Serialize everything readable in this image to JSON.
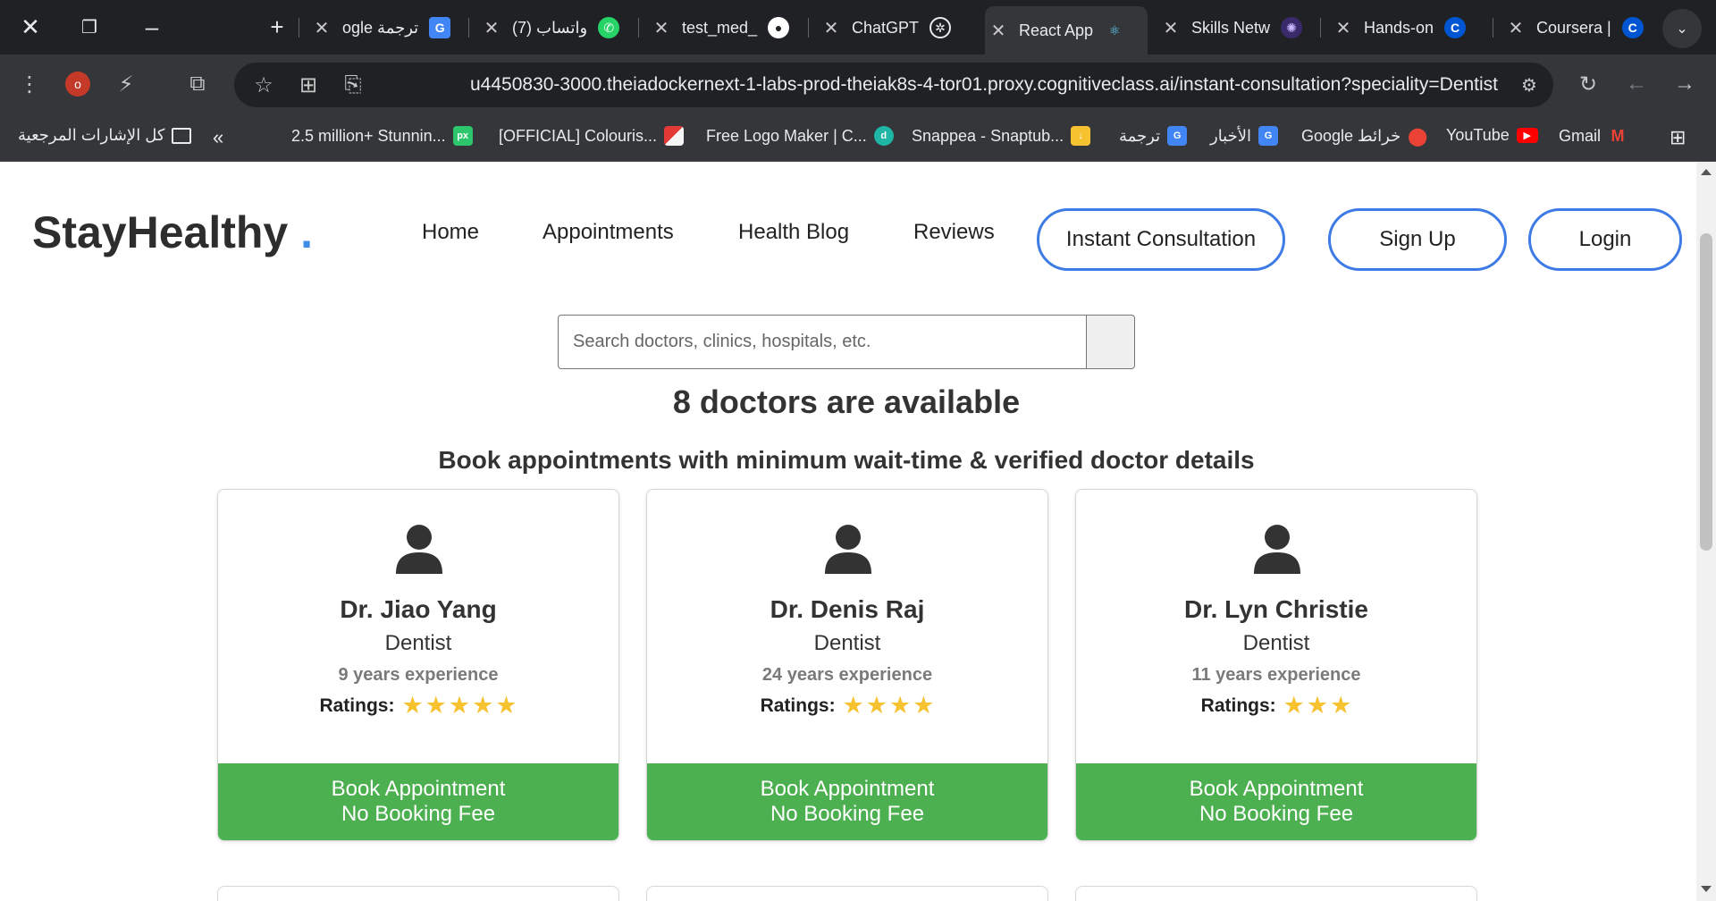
{
  "browser": {
    "tabs": [
      {
        "title": "ogle ترجمة",
        "icon": "google-translate-icon"
      },
      {
        "title": "(7) واتساب",
        "icon": "whatsapp-icon"
      },
      {
        "title": "test_med_",
        "icon": "github-icon"
      },
      {
        "title": "ChatGPT",
        "icon": "chatgpt-icon"
      },
      {
        "title": "React App",
        "icon": "react-icon",
        "active": true
      },
      {
        "title": "Skills Netw",
        "icon": "skills-network-icon"
      },
      {
        "title": "Hands-on",
        "icon": "coursera-icon"
      },
      {
        "title": "Coursera |",
        "icon": "coursera-icon"
      }
    ],
    "profile_initial": "o",
    "url": "u4450830-3000.theiadockernext-1-labs-prod-theiak8s-4-tor01.proxy.cognitiveclass.ai/instant-consultation?speciality=Dentist",
    "bookmarks": [
      {
        "label": "كل الإشارات المرجعية"
      },
      {
        "label": "2.5 million+ Stunnin...",
        "badge": "px"
      },
      {
        "label": "[OFFICIAL] Colouris..."
      },
      {
        "label": "Free Logo Maker | C..."
      },
      {
        "label": "Snappea - Snaptub..."
      },
      {
        "label": "ترجمة"
      },
      {
        "label": "الأخبار"
      },
      {
        "label": "Google خرائط"
      },
      {
        "label": "YouTube"
      },
      {
        "label": "Gmail"
      }
    ]
  },
  "site": {
    "logo": "StayHealthy",
    "logo_dot": ".",
    "nav": {
      "home": "Home",
      "appointments": "Appointments",
      "blog": "Health Blog",
      "reviews": "Reviews",
      "instant": "Instant Consultation",
      "signup": "Sign Up",
      "login": "Login"
    },
    "search": {
      "placeholder": "Search doctors, clinics, hospitals, etc.",
      "value": ""
    },
    "headline": "8 doctors are available",
    "subhead": "Book appointments with minimum wait-time & verified doctor details",
    "rating_label": "Ratings:",
    "book_line1": "Book Appointment",
    "book_line2": "No Booking Fee",
    "doctors": [
      {
        "name": "Dr. Jiao Yang",
        "speciality": "Dentist",
        "experience": "9 years experience",
        "stars": 5
      },
      {
        "name": "Dr. Denis Raj",
        "speciality": "Dentist",
        "experience": "24 years experience",
        "stars": 4
      },
      {
        "name": "Dr. Lyn Christie",
        "speciality": "Dentist",
        "experience": "11 years experience",
        "stars": 3
      }
    ]
  },
  "colors": {
    "accent_blue": "#3e7be5",
    "book_green": "#4caf50",
    "star_yellow": "#f6c22f"
  }
}
